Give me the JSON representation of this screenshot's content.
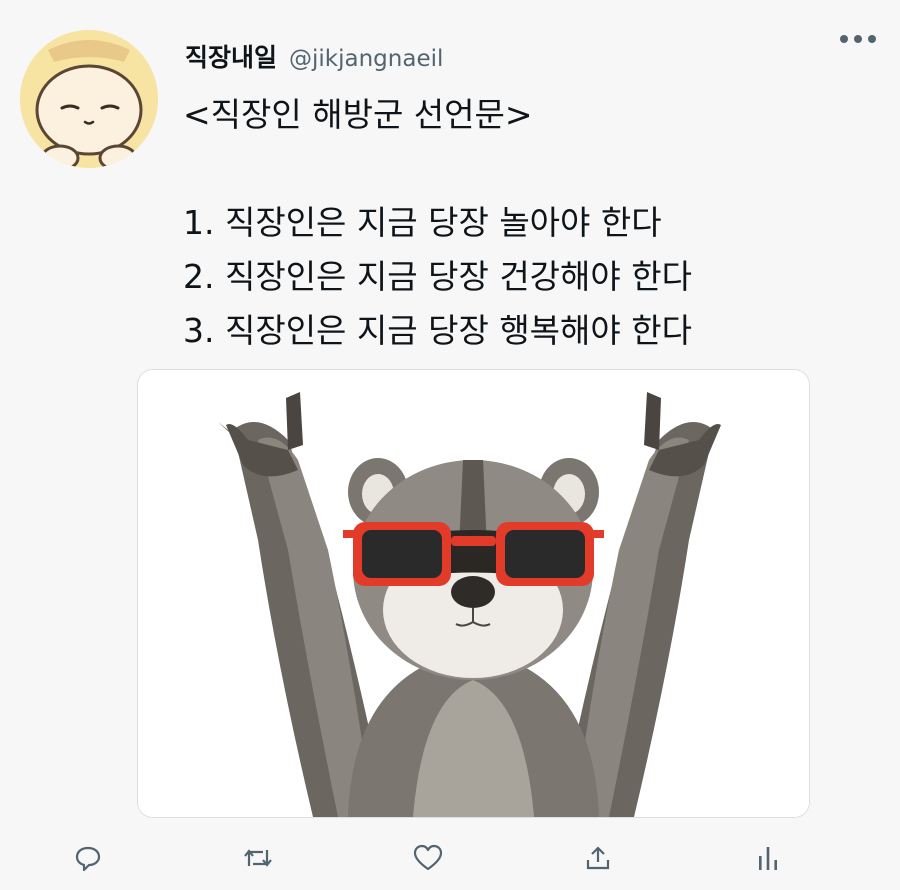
{
  "tweet": {
    "author": {
      "display_name": "직장내일",
      "handle": "@jikjangnaeil",
      "avatar_icon": "cartoon-character-avatar"
    },
    "title_line": "<직장인 해방군 선언문>",
    "list_items": [
      "1. 직장인은 지금 당장 놀아야 한다",
      "2. 직장인은 지금 당장 건강해야 한다",
      "3. 직장인은 지금 당장 행복해야 한다"
    ],
    "media": {
      "icon": "raccoon-wearing-red-sunglasses-photo"
    }
  },
  "actions": {
    "reply_icon": "reply-icon",
    "retweet_icon": "retweet-icon",
    "like_icon": "heart-icon",
    "share_icon": "share-icon",
    "analytics_icon": "analytics-icon"
  },
  "colors": {
    "background": "#f7f7f7",
    "text": "#0f1419",
    "secondary_text": "#536471",
    "sunglasses": "#e23b2a"
  }
}
